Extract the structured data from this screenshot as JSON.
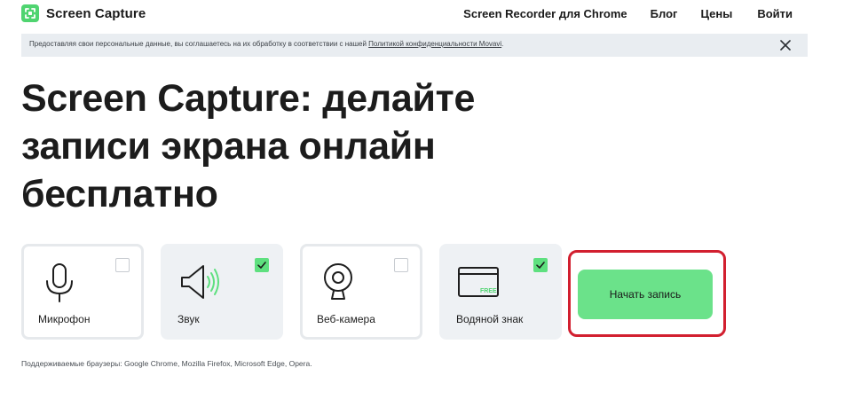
{
  "header": {
    "logo_text": "Screen Capture",
    "nav": [
      {
        "label": "Screen Recorder для Chrome"
      },
      {
        "label": "Блог"
      },
      {
        "label": "Цены"
      },
      {
        "label": "Войти"
      }
    ]
  },
  "consent": {
    "text": "Предоставляя свои персональные данные, вы соглашаетесь на их обработку в соответствии с нашей ",
    "link_text": "Политикой конфиденциальности Movavi",
    "suffix": "."
  },
  "hero": {
    "title_line1": "Screen Capture: делайте",
    "title_line2": "записи экрана онлайн",
    "title_line3": "бесплатно"
  },
  "options": [
    {
      "label": "Микрофон",
      "checked": false,
      "icon": "microphone-icon"
    },
    {
      "label": "Звук",
      "checked": true,
      "icon": "speaker-icon"
    },
    {
      "label": "Веб-камера",
      "checked": false,
      "icon": "webcam-icon"
    },
    {
      "label": "Водяной знак",
      "checked": true,
      "icon": "watermark-icon",
      "badge": "FREE"
    }
  ],
  "start_button": {
    "label": "Начать запись"
  },
  "footer": {
    "browsers": "Поддерживаемые браузеры: Google Chrome, Mozilla Firefox, Microsoft Edge, Opera."
  },
  "colors": {
    "accent_green": "#6be28a",
    "highlight_red": "#d21f2f",
    "consent_bg": "#e9edf1"
  }
}
